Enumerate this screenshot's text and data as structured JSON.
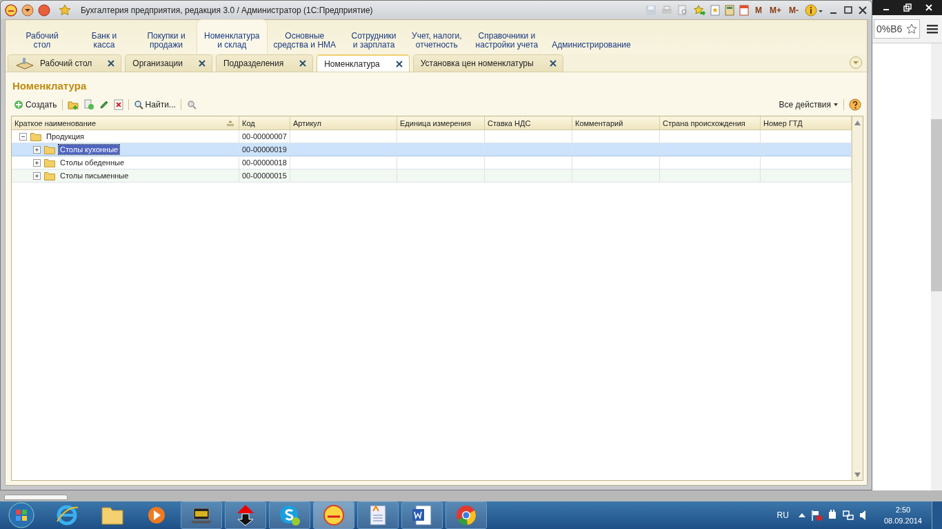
{
  "window": {
    "title": "Бухгалтерия предприятия, редакция 3.0 / Администратор  (1С:Предприятие)",
    "memory_buttons": [
      "M",
      "M+",
      "M-"
    ]
  },
  "sections": [
    {
      "label": "Рабочий\nстол",
      "selected": false
    },
    {
      "label": "Банк и\nкасса",
      "selected": false
    },
    {
      "label": "Покупки и\nпродажи",
      "selected": false
    },
    {
      "label": "Номенклатура\nи склад",
      "selected": true
    },
    {
      "label": "Основные\nсредства и НМА",
      "selected": false
    },
    {
      "label": "Сотрудники\nи зарплата",
      "selected": false
    },
    {
      "label": "Учет, налоги,\nотчетность",
      "selected": false
    },
    {
      "label": "Справочники и\nнастройки учета",
      "selected": false
    },
    {
      "label": "Администрирование",
      "selected": false
    }
  ],
  "tabs": [
    {
      "label": "Рабочий стол",
      "kind": "desktop",
      "selected": false
    },
    {
      "label": "Организации",
      "kind": "form",
      "selected": false
    },
    {
      "label": "Подразделения",
      "kind": "form",
      "selected": false
    },
    {
      "label": "Номенклатура",
      "kind": "form",
      "selected": true
    },
    {
      "label": "Установка цен номенклатуры",
      "kind": "form",
      "selected": false
    }
  ],
  "form": {
    "title": "Номенклатура",
    "create": "Создать",
    "find": "Найти...",
    "all_actions": "Все действия"
  },
  "table": {
    "columns": [
      {
        "label": "Краткое наименование",
        "sorted": true
      },
      {
        "label": "Код",
        "sorted": false
      },
      {
        "label": "Артикул",
        "sorted": false
      },
      {
        "label": "Единица измерения",
        "sorted": false
      },
      {
        "label": "Ставка НДС",
        "sorted": false
      },
      {
        "label": "Комментарий",
        "sorted": false
      },
      {
        "label": "Страна происхождения",
        "sorted": false
      },
      {
        "label": "Номер ГТД",
        "sorted": false
      }
    ],
    "rows": [
      {
        "name": "Продукция",
        "code": "00-00000007",
        "expanded": true,
        "selected": false,
        "children": [
          {
            "name": "Столы кухонные",
            "code": "00-00000019",
            "expanded": false,
            "selected": true
          },
          {
            "name": "Столы обеденные",
            "code": "00-00000018",
            "expanded": false,
            "selected": false
          },
          {
            "name": "Столы письменные",
            "code": "00-00000015",
            "expanded": false,
            "selected": false
          }
        ]
      }
    ]
  },
  "browser": {
    "address_fragment": "0%B6"
  },
  "taskbar": {
    "language": "RU",
    "time": "2:50",
    "date": "08.09.2014"
  }
}
